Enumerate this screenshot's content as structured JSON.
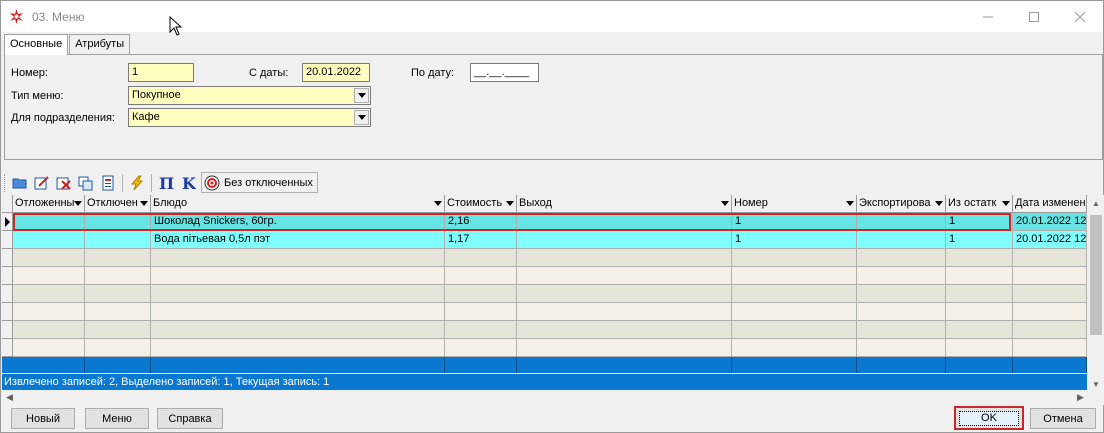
{
  "window": {
    "title": "03. Меню",
    "controls": [
      "minimize-icon",
      "maximize-icon",
      "close-icon"
    ]
  },
  "tabs": [
    {
      "label": "Основные",
      "active": true
    },
    {
      "label": "Атрибуты",
      "active": false
    }
  ],
  "form": {
    "number_label": "Номер:",
    "number_value": "1",
    "date_from_label": "С даты:",
    "date_from_value": "20.01.2022",
    "date_to_label": "По дату:",
    "date_to_value": "__.__.____",
    "menu_type_label": "Тип меню:",
    "menu_type_value": "Покупное",
    "department_label": "Для подразделения:",
    "department_value": "Кафе"
  },
  "toolbar": {
    "icons": [
      "open-folder-icon",
      "edit-icon",
      "delete-icon",
      "copy-icon",
      "properties-icon",
      "lightning-icon",
      "pi-icon",
      "k-icon",
      "target-icon"
    ],
    "filter_label": "Без отключенных"
  },
  "grid": {
    "columns": [
      "Отложенны",
      "Отключен",
      "Блюдо",
      "Стоимость",
      "Выход",
      "Номер",
      "Экспортирова",
      "Из остатк",
      "Дата изменен"
    ],
    "rows": [
      {
        "cells": [
          "",
          "",
          "Шоколад Snickers, 60гр.",
          "2,16",
          "",
          "1",
          "",
          "1",
          "20.01.2022 12"
        ],
        "selected": true
      },
      {
        "cells": [
          "",
          "",
          "Вода пітьевая 0,5л пэт",
          "1,17",
          "",
          "1",
          "",
          "1",
          "20.01.2022 12"
        ],
        "selected": false
      }
    ],
    "empty_rows": 6
  },
  "status": "Извлечено записей: 2, Выделено записей: 1, Текущая запись: 1",
  "buttons": {
    "new": "Новый",
    "menu": "Меню",
    "help": "Справка",
    "ok": "OK",
    "cancel": "Отмена"
  },
  "colors": {
    "selected_row": "#66e3e3",
    "row": "#80ffff",
    "empty_row_a": "#f5f0e6",
    "empty_row_b": "#e6e6d8",
    "status_bg": "#0a78d0",
    "field_bg": "#ffffc0"
  }
}
